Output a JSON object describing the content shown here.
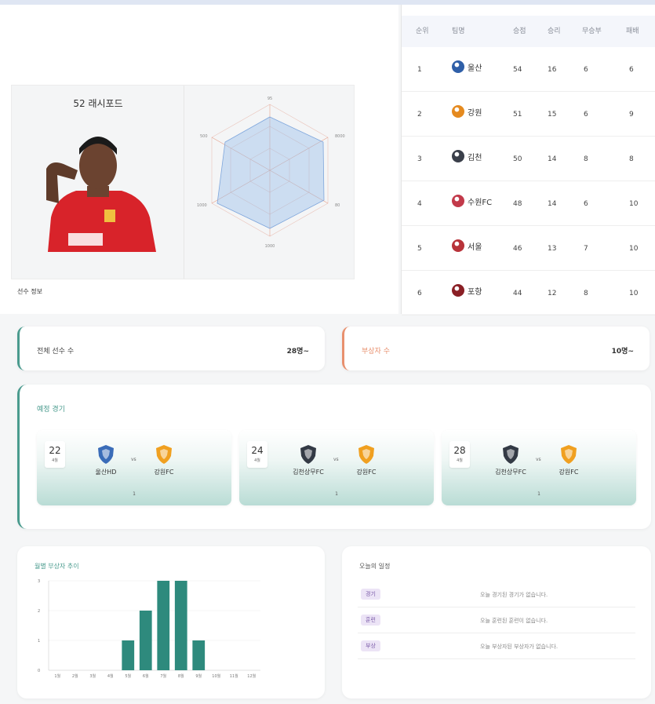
{
  "player": {
    "name": "52 래시포드",
    "info_label": "선수 정보",
    "radar_labels": [
      "95",
      "8000",
      "80",
      "1000",
      "1000",
      "500"
    ]
  },
  "standings": {
    "headers": [
      "순위",
      "팀명",
      "승점",
      "승리",
      "무승부",
      "패배"
    ],
    "rows": [
      {
        "rank": "1",
        "team": "울산",
        "points": "54",
        "wins": "16",
        "draws": "6",
        "losses": "6",
        "color": "#2f5fa8"
      },
      {
        "rank": "2",
        "team": "강원",
        "points": "51",
        "wins": "15",
        "draws": "6",
        "losses": "9",
        "color": "#e58a1f"
      },
      {
        "rank": "3",
        "team": "김천",
        "points": "50",
        "wins": "14",
        "draws": "8",
        "losses": "8",
        "color": "#3a3f4a"
      },
      {
        "rank": "4",
        "team": "수원FC",
        "points": "48",
        "wins": "14",
        "draws": "6",
        "losses": "10",
        "color": "#c23a4a"
      },
      {
        "rank": "5",
        "team": "서울",
        "points": "46",
        "wins": "13",
        "draws": "7",
        "losses": "10",
        "color": "#b8333a"
      },
      {
        "rank": "6",
        "team": "포항",
        "points": "44",
        "wins": "12",
        "draws": "8",
        "losses": "10",
        "color": "#8a1f25"
      }
    ]
  },
  "summary": {
    "total_players_label": "전체 선수 수",
    "total_players_value": "28명~",
    "injured_label": "부상자 수",
    "injured_value": "10명~"
  },
  "matches": {
    "title": "예정 경기",
    "vs_label": "vs",
    "items": [
      {
        "day": "22",
        "month": "4월",
        "home": "울산HD",
        "away": "강원FC",
        "extra": "1",
        "home_color": "#3a6cb8",
        "away_color": "#f0a020"
      },
      {
        "day": "24",
        "month": "4월",
        "home": "김천상무FC",
        "away": "강원FC",
        "extra": "1",
        "home_color": "#333a45",
        "away_color": "#f0a020"
      },
      {
        "day": "28",
        "month": "4월",
        "home": "김천상무FC",
        "away": "강원FC",
        "extra": "1",
        "home_color": "#333a45",
        "away_color": "#f0a020"
      }
    ]
  },
  "chart_data": {
    "type": "bar",
    "title": "월별 부상자 추이",
    "categories": [
      "1월",
      "2월",
      "3월",
      "4월",
      "5월",
      "6월",
      "7월",
      "8월",
      "9월",
      "10월",
      "11월",
      "12월"
    ],
    "values": [
      0,
      0,
      0,
      0,
      1,
      2,
      3,
      3,
      1,
      0,
      0,
      0
    ],
    "ylim": [
      0,
      3
    ],
    "yticks": [
      "0",
      "1",
      "2",
      "3"
    ],
    "color": "#2e8a7d"
  },
  "schedule": {
    "title": "오늘의 일정",
    "items": [
      {
        "tag": "경기",
        "text": "오늘 경기된 경기가 없습니다."
      },
      {
        "tag": "훈련",
        "text": "오늘 훈련된 훈련이 없습니다."
      },
      {
        "tag": "부상",
        "text": "오늘 부상자된 부상자가 없습니다."
      }
    ]
  }
}
